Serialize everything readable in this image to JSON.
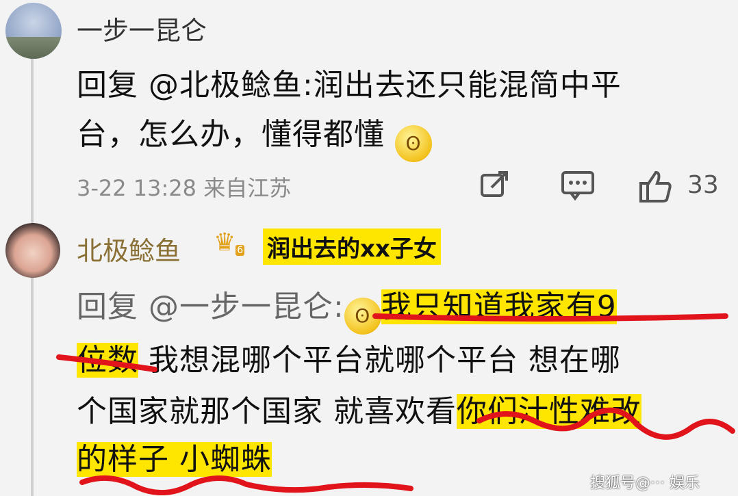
{
  "comment1": {
    "username": "一步一昆仑",
    "line1": "回复 @北极鲶鱼:润出去还只能混简中平",
    "line2": "台，怎么办，懂得都懂",
    "emoji": "emoji-cover-mouth",
    "meta": "3-22 13:28 来自江苏",
    "like_count": "33"
  },
  "comment2": {
    "username": "北极鲶鱼",
    "badge_level": "6",
    "badge": "润出去的xx子女",
    "line1_prefix": "回复 @一步一昆仑:",
    "line1_highlight": "我只知道我家有9",
    "line2_highlight": "位数",
    "line2_rest": "我想混哪个平台就哪个平台 想在哪",
    "line3_rest": "个国家就那个国家 就喜欢看",
    "line3_highlight": "你们汁性难改",
    "line4_highlight": "的样子 小蜘蛛"
  },
  "icons": {
    "share": "share-icon",
    "comment": "comment-icon",
    "like": "thumbs-up-icon",
    "crown": "crown-icon"
  },
  "watermark": "搜狐号@··· 娱乐",
  "colors": {
    "highlight": "#ffe600",
    "underline": "#e0141a",
    "username2": "#8a7034",
    "background": "#f3f3f3"
  }
}
